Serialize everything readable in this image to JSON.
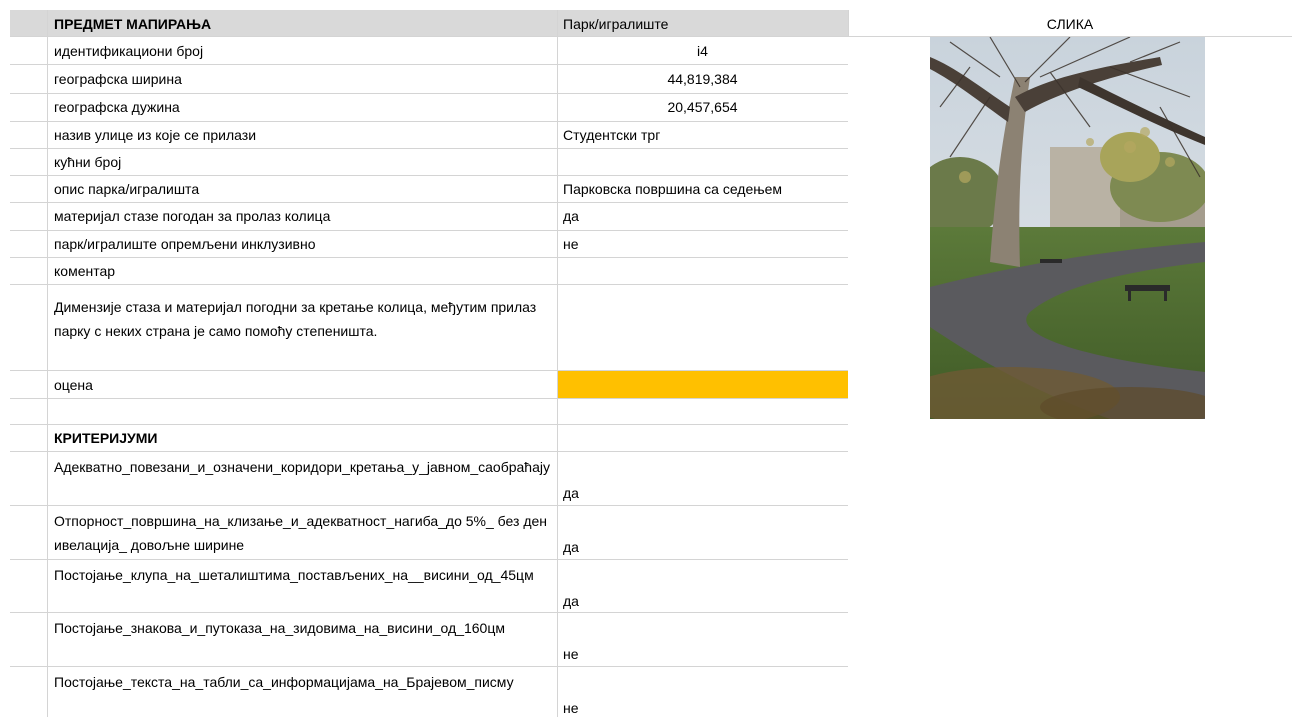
{
  "sheet": {
    "header_label": "ПРЕДМЕТ МАПИРАЊА",
    "header_value": "Парк/игралиште",
    "image_header": "СЛИКА",
    "rows": [
      {
        "label": "идентификациони број",
        "value": "i4"
      },
      {
        "label": "географска ширина",
        "value": "44,819,384"
      },
      {
        "label": "географска дужина",
        "value": "20,457,654"
      },
      {
        "label": "назив улице из које се прилази",
        "value": "Студентски трг"
      },
      {
        "label": "кућни број",
        "value": ""
      },
      {
        "label": "опис парка/игралишта",
        "value": "Парковска површина са седењем"
      },
      {
        "label": "материјал стазе погодан за пролаз колица",
        "value": "да"
      },
      {
        "label": "парк/игралиште опремљени инклузивно",
        "value": "не"
      },
      {
        "label": "коментар",
        "value": ""
      }
    ],
    "comment": "Димензије стаза и материјал погодни за кретање колица, међутим прилаз парку с неких страна је само помоћу степеништа.",
    "rating_label": "оцена",
    "rating_color": "#ffc000",
    "criteria_header": "КРИТЕРИЈУМИ",
    "criteria": [
      {
        "label": "Адекватно_повезани_и_означени_коридори_кретања_у_јавном_саобраћају",
        "value": "да"
      },
      {
        "label": "Отпорност_површина_на_клизање_и_адекватност_нагиба_до 5%_ без денивелација_ довољне ширине",
        "value": "да"
      },
      {
        "label": "Постојање_клупа_на_шеталиштима_постављених_на__висини_од_45цм",
        "value": "да"
      },
      {
        "label": "Постојање_знакова_и_путоказа_на_зидовима_на_висини_од_160цм",
        "value": "не"
      },
      {
        "label": "Постојање_текста_на_табли_са_информацијама_на_Брајевом_писму",
        "value": "не"
      }
    ]
  }
}
